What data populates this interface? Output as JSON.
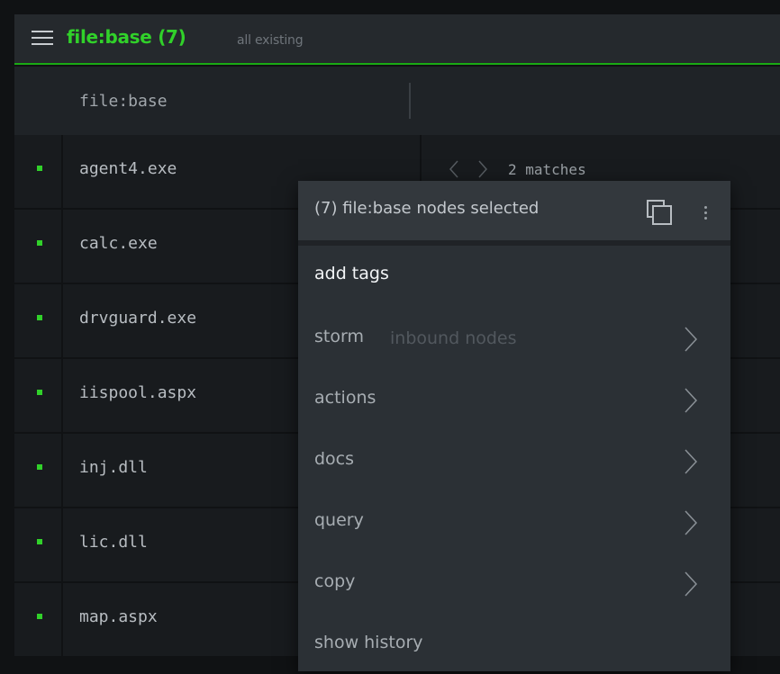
{
  "topbar": {
    "title": "file:base (7)",
    "subtitle": "all existing",
    "accent_color": "#31d12a",
    "menu_icon": "hamburger-icon"
  },
  "table": {
    "column_header": "file:base",
    "rows": [
      "agent4.exe",
      "calc.exe",
      "drvguard.exe",
      "iispool.aspx",
      "inj.dll",
      "lic.dll",
      "map.aspx"
    ]
  },
  "matches": {
    "prev_icon": "chevron-left-icon",
    "next_icon": "chevron-right-icon",
    "text": "2 matches"
  },
  "context_menu": {
    "header": "(7) file:base nodes selected",
    "copy_icon": "copy-icon",
    "more_icon": "more-vertical-icon",
    "items": [
      {
        "label": "add tags",
        "sub": "",
        "has_submenu": false
      },
      {
        "label": "storm",
        "sub": "inbound nodes",
        "has_submenu": true
      },
      {
        "label": "actions",
        "sub": "",
        "has_submenu": true
      },
      {
        "label": "docs",
        "sub": "",
        "has_submenu": true
      },
      {
        "label": "query",
        "sub": "",
        "has_submenu": true
      },
      {
        "label": "copy",
        "sub": "",
        "has_submenu": true
      },
      {
        "label": "show history",
        "sub": "",
        "has_submenu": false
      }
    ]
  }
}
